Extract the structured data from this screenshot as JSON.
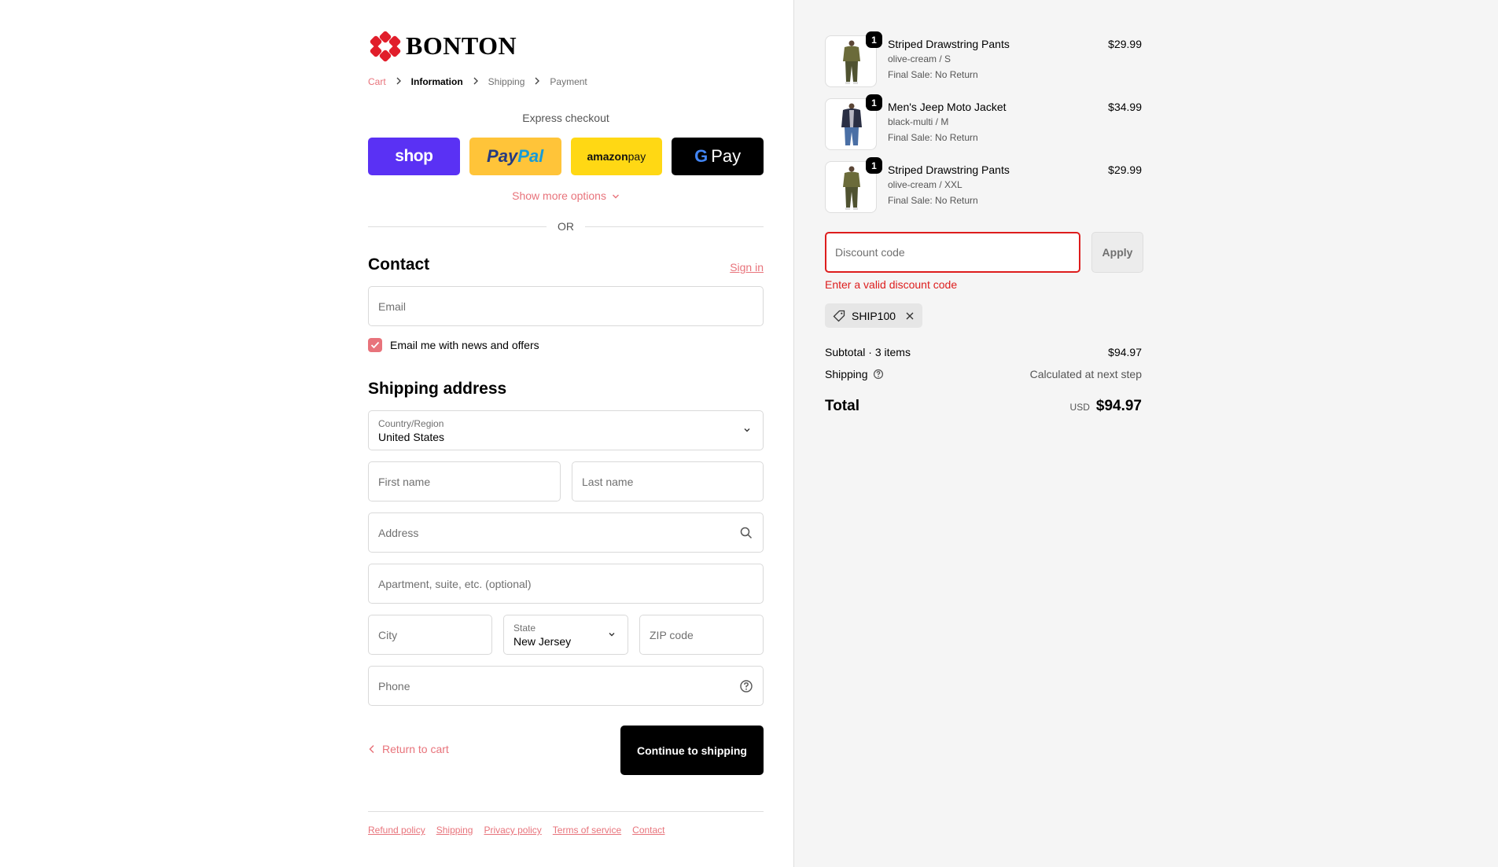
{
  "brand": {
    "name": "BONTON",
    "logo_color": "#e11d2a"
  },
  "breadcrumb": [
    {
      "label": "Cart",
      "state": "link"
    },
    {
      "label": "Information",
      "state": "active"
    },
    {
      "label": "Shipping",
      "state": "inactive"
    },
    {
      "label": "Payment",
      "state": "inactive"
    }
  ],
  "express": {
    "title": "Express checkout",
    "buttons": {
      "shop": "shop",
      "paypal_a": "Pay",
      "paypal_b": "Pal",
      "amazon_a": "amazon",
      "amazon_b": " pay",
      "gpay_g": "G",
      "gpay": "Pay"
    },
    "more_options": "Show more options",
    "or": "OR"
  },
  "contact": {
    "title": "Contact",
    "signin": "Sign in",
    "email_placeholder": "Email",
    "newsletter_label": "Email me with news and offers",
    "newsletter_checked": true
  },
  "shipping": {
    "title": "Shipping address",
    "country_label": "Country/Region",
    "country_value": "United States",
    "first_name": "First name",
    "last_name": "Last name",
    "address": "Address",
    "apartment": "Apartment, suite, etc. (optional)",
    "city": "City",
    "state_label": "State",
    "state_value": "New Jersey",
    "zip": "ZIP code",
    "phone": "Phone"
  },
  "actions": {
    "return": "Return to cart",
    "continue": "Continue to shipping"
  },
  "footer": [
    "Refund policy",
    "Shipping",
    "Privacy policy",
    "Terms of service",
    "Contact"
  ],
  "cart": {
    "items": [
      {
        "name": "Striped Drawstring Pants",
        "variant": "olive-cream / S",
        "note": "Final Sale: No Return",
        "price": "$29.99",
        "qty": "1",
        "image": "olive-pants"
      },
      {
        "name": "Men's Jeep Moto Jacket",
        "variant": "black-multi / M",
        "note": "Final Sale: No Return",
        "price": "$34.99",
        "qty": "1",
        "image": "moto-jacket"
      },
      {
        "name": "Striped Drawstring Pants",
        "variant": "olive-cream / XXL",
        "note": "Final Sale: No Return",
        "price": "$29.99",
        "qty": "1",
        "image": "olive-pants"
      }
    ],
    "discount_placeholder": "Discount code",
    "apply": "Apply",
    "discount_error": "Enter a valid discount code",
    "applied_code": "SHIP100",
    "subtotal_label": "Subtotal · 3 items",
    "subtotal_value": "$94.97",
    "shipping_label": "Shipping",
    "shipping_value": "Calculated at next step",
    "total_label": "Total",
    "currency": "USD",
    "total_value": "$94.97"
  },
  "colors": {
    "accent": "#e8737b",
    "error": "#dd1d1d",
    "shop": "#5a31f4",
    "paypal": "#ffc439",
    "amazon": "#ffd814"
  }
}
